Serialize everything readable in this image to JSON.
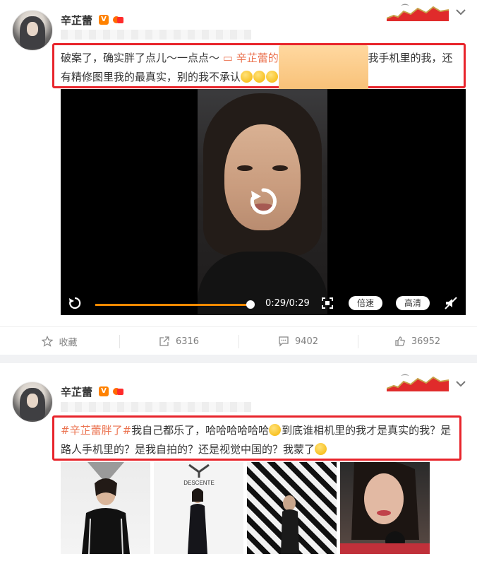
{
  "post1": {
    "username": "辛芷蕾",
    "vbadge": "V",
    "text_before_link": "破案了，确实胖了点儿～一点点～ ",
    "link_text": "辛芷蕾的",
    "text_after_link": " 但我认为我手机里的我，还有精修图里我的最真实，别的我不承认",
    "video": {
      "time": "0:29/0:29",
      "speed_label": "倍速",
      "quality_label": "高清",
      "progress": 0.97
    },
    "actions": {
      "favorite_label": "收藏",
      "share_count": "6316",
      "comment_count": "9402",
      "like_count": "36952"
    }
  },
  "post2": {
    "username": "辛芷蕾",
    "vbadge": "V",
    "hashtag": "#辛芷蕾胖了#",
    "text_part1": "我自己都乐了，哈哈哈哈哈哈",
    "text_part2": "到底谁相机里的我才是真实的我？是路人手机里的？是我自拍的？还是视觉中国的？我蒙了",
    "thumb2_logo": "DESCENTE"
  },
  "colors": {
    "accent": "#eb7350",
    "highlight_border": "#e8242b",
    "progress": "#ff8a00"
  }
}
